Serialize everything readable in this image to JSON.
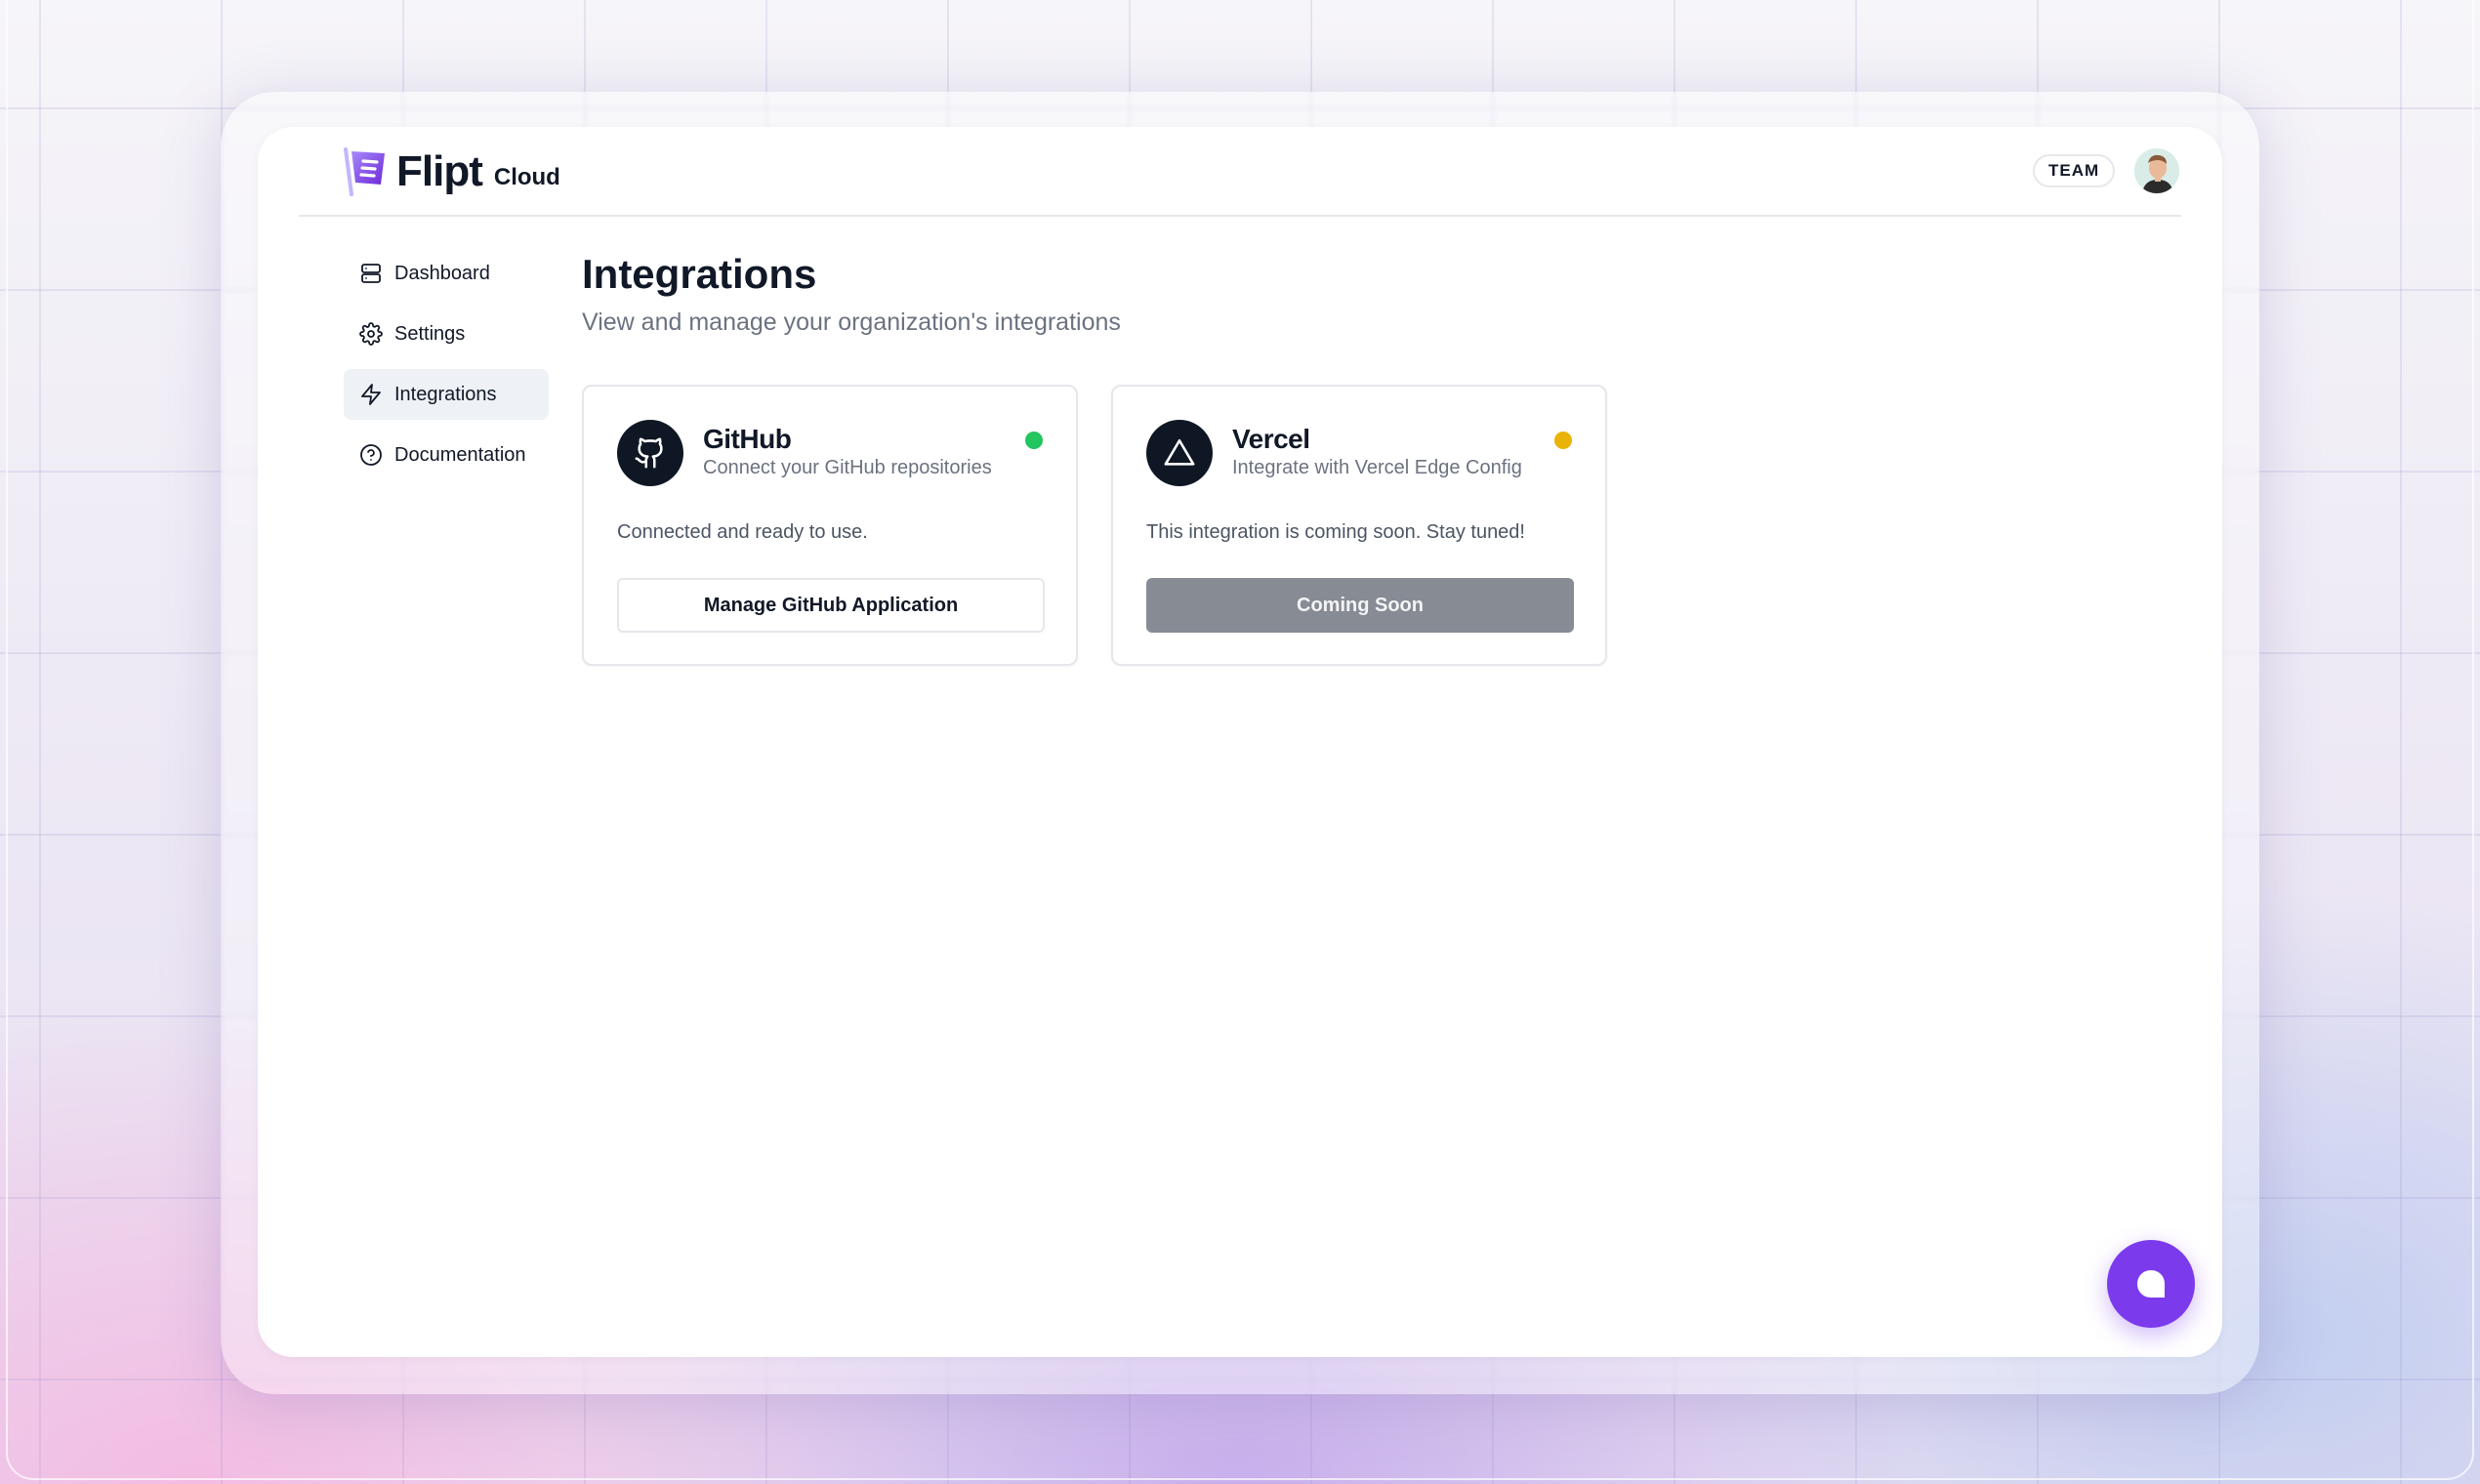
{
  "brand": {
    "name": "Flipt",
    "sub": "Cloud",
    "accent": "#7c3aed"
  },
  "header": {
    "team_badge": "TEAM",
    "avatar_icon": "user-avatar"
  },
  "sidebar": {
    "items": [
      {
        "label": "Dashboard",
        "icon": "server-icon",
        "active": false
      },
      {
        "label": "Settings",
        "icon": "gear-icon",
        "active": false
      },
      {
        "label": "Integrations",
        "icon": "zap-icon",
        "active": true
      },
      {
        "label": "Documentation",
        "icon": "help-circle-icon",
        "active": false
      }
    ]
  },
  "main": {
    "title": "Integrations",
    "subtitle": "View and manage your organization's integrations",
    "cards": [
      {
        "name": "GitHub",
        "description": "Connect your GitHub repositories",
        "icon": "github-icon",
        "status_color": "#22c55e",
        "body": "Connected and ready to use.",
        "button": "Manage GitHub Application",
        "button_style": "outline"
      },
      {
        "name": "Vercel",
        "description": "Integrate with Vercel Edge Config",
        "icon": "vercel-triangle-icon",
        "status_color": "#eab308",
        "body": "This integration is coming soon. Stay tuned!",
        "button": "Coming Soon",
        "button_style": "disabled"
      }
    ]
  },
  "chat": {
    "icon": "chat-bubble-icon"
  }
}
